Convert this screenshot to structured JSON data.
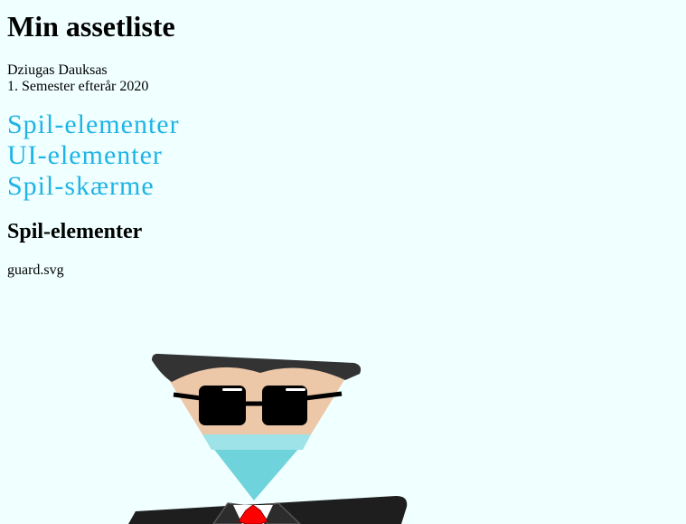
{
  "header": {
    "title": "Min assetliste"
  },
  "author": {
    "name": "Dziugas Dauksas",
    "semester": "1. Semester efterår 2020"
  },
  "nav": {
    "items": [
      {
        "label": "Spil-elementer"
      },
      {
        "label": "UI-elementer"
      },
      {
        "label": "Spil-skærme"
      }
    ],
    "link_color": "#1fb4e6"
  },
  "section": {
    "title": "Spil-elementer",
    "asset_filename": "guard.svg"
  },
  "colors": {
    "page_background": "#f0ffff",
    "guard_hair": "#333333",
    "guard_skin": "#ecc8a9",
    "guard_sunglasses": "#000000",
    "guard_mask": "#6fd3db",
    "guard_suit": "#1e1e1e",
    "guard_tie": "#ff0000"
  }
}
